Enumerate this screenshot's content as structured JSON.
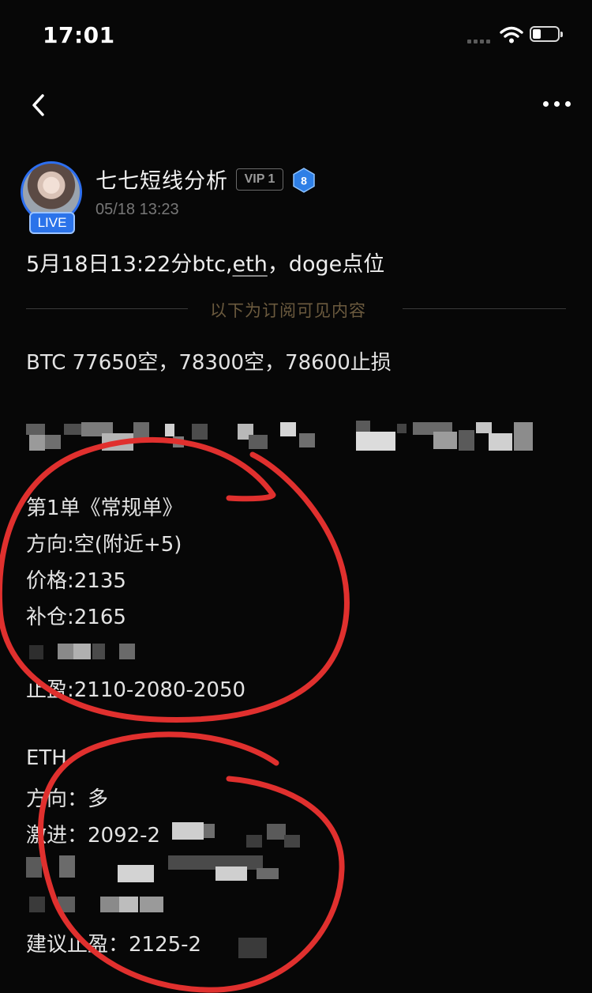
{
  "status_bar": {
    "time": "17:01"
  },
  "nav": {
    "back_icon": "chevron-left-icon",
    "more_icon": "more-horizontal-icon"
  },
  "author": {
    "name": "七七短线分析",
    "live_label": "LIVE",
    "vip_label": "VIP 1",
    "level": "8",
    "timestamp": "05/18 13:23"
  },
  "post": {
    "title_prefix": "5月18日13:22分btc,",
    "title_underlined": "eth",
    "title_suffix": "，doge点位",
    "subscriber_divider": "以下为订阅可见内容",
    "lines": {
      "btc": "BTC 77650空，78300空，78600止损",
      "order_title": "第1单《常规单》",
      "direction": "方向:空(附近+5)",
      "price": "价格:2135",
      "add_position": "补仓:2165",
      "take_profit": "止盈:2110-2080-2050",
      "eth_label": "ETH",
      "eth_direction": "方向：多",
      "eth_aggressive": "激进：2092-2",
      "eth_take_profit": "建议止盈：2125-2"
    }
  },
  "colors": {
    "background": "#070707",
    "accent_blue": "#2b73ea",
    "divider_text": "#6b5a3e",
    "annotation_red": "#e0302e"
  }
}
